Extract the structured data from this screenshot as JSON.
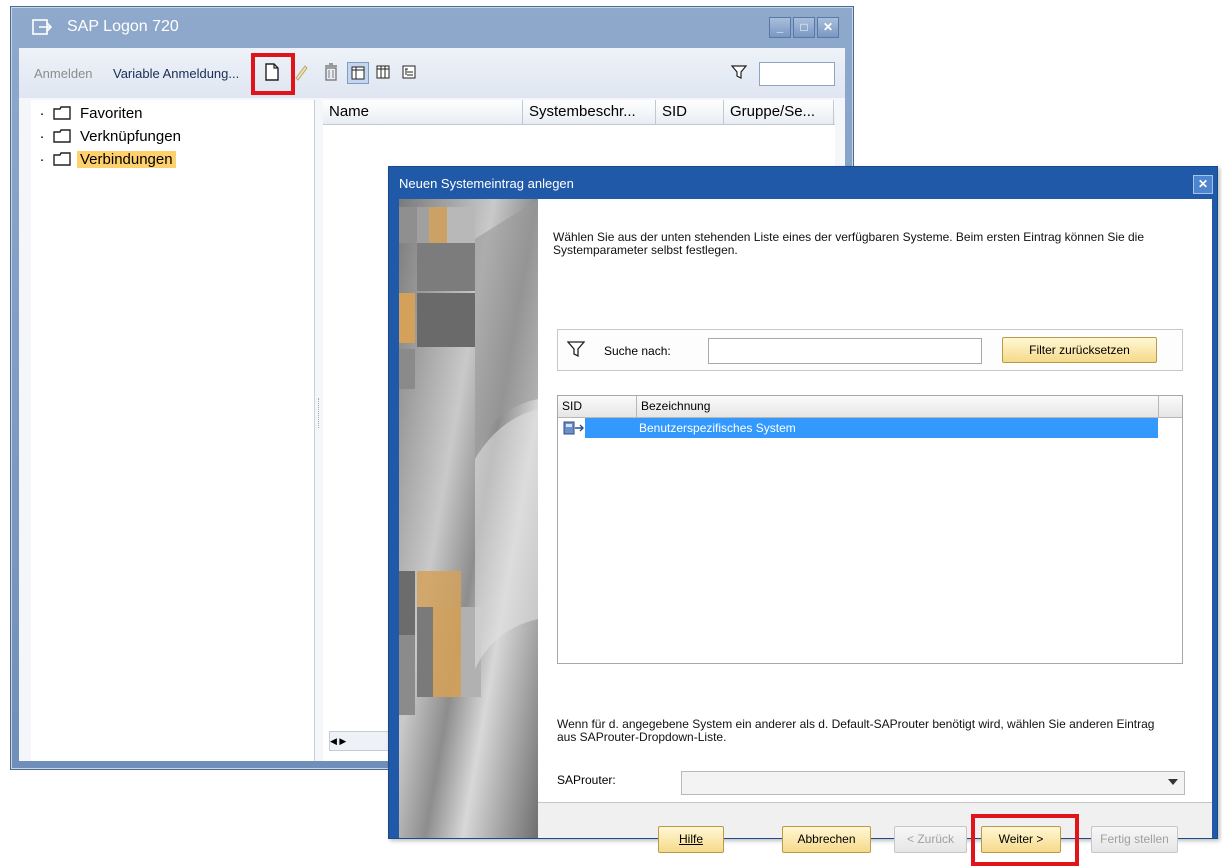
{
  "logon": {
    "title": "SAP Logon 720",
    "window_controls": [
      "_",
      "□",
      "✕"
    ],
    "toolbar": {
      "anmelden": "Anmelden",
      "variable": "Variable Anmeldung..."
    },
    "tree": [
      {
        "label": "Favoriten",
        "selected": false
      },
      {
        "label": "Verknüpfungen",
        "selected": false
      },
      {
        "label": "Verbindungen",
        "selected": true
      }
    ],
    "columns": [
      "Name",
      "Systembeschr...",
      "SID",
      "Gruppe/Se..."
    ],
    "scroll_arrows": "◀ ▶"
  },
  "dialog": {
    "title": "Neuen Systemeintrag anlegen",
    "close": "✕",
    "intro": "Wählen Sie aus der unten stehenden Liste eines der verfügbaren Systeme. Beim ersten Eintrag können Sie die Systemparameter selbst festlegen.",
    "search_label": "Suche nach:",
    "search_value": "",
    "filter_reset": "Filter zurücksetzen",
    "grid_columns": [
      "SID",
      "Bezeichnung"
    ],
    "grid_rows": [
      {
        "sid": "",
        "bezeichnung": "Benutzerspezifisches System",
        "selected": true
      }
    ],
    "hint": "Wenn für d. angegebene System ein anderer als d. Default-SAProuter benötigt wird, wählen Sie anderen Eintrag aus SAProuter-Dropdown-Liste.",
    "router_label": "SAProuter:",
    "router_value": "",
    "buttons": {
      "hilfe": "Hilfe",
      "abbrechen": "Abbrechen",
      "zurueck": "< Zurück",
      "weiter": "Weiter >",
      "fertig": "Fertig stellen"
    }
  },
  "colors": {
    "highlight": "#e0141b",
    "selection": "#3399ff",
    "folder_selected": "#ffd16d",
    "dialog_title": "#1f59a8"
  },
  "icons": [
    "logon-icon",
    "new-entry-icon",
    "edit-icon",
    "delete-icon",
    "view-list-icon",
    "view-grid-icon",
    "view-tree-icon",
    "filter-icon",
    "folder-icon",
    "system-icon"
  ]
}
